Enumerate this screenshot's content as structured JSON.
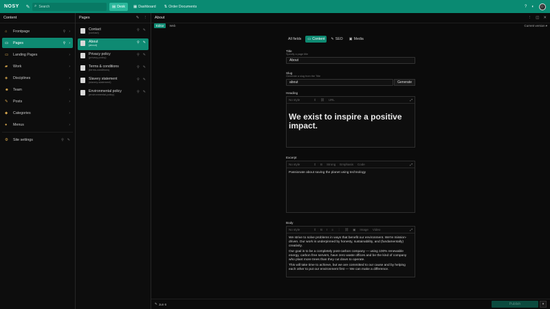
{
  "topbar": {
    "brand": "NOSY",
    "search_placeholder": "Search",
    "tools": [
      {
        "label": "Desk",
        "icon": "desk-icon",
        "active": true
      },
      {
        "label": "Dashboard",
        "icon": "dashboard-icon",
        "active": false
      },
      {
        "label": "Order Documents",
        "icon": "order-documents-icon",
        "active": false
      }
    ]
  },
  "content_pane": {
    "title": "Content",
    "items": [
      {
        "label": "Frontpage",
        "icon": "home-icon"
      },
      {
        "label": "Pages",
        "icon": "pages-icon",
        "active": true
      },
      {
        "label": "Landing Pages",
        "icon": "landing-pages-icon"
      },
      {
        "label": "Work",
        "icon": "work-icon"
      },
      {
        "label": "Disciplines",
        "icon": "disciplines-icon"
      },
      {
        "label": "Team",
        "icon": "team-icon"
      },
      {
        "label": "Posts",
        "icon": "posts-icon"
      },
      {
        "label": "Categories",
        "icon": "categories-icon"
      },
      {
        "label": "Menus",
        "icon": "menus-icon"
      },
      {
        "label": "Site settings",
        "icon": "settings-icon"
      }
    ]
  },
  "pages_pane": {
    "title": "Pages",
    "docs": [
      {
        "title": "Contact",
        "slug": "(contact)"
      },
      {
        "title": "About",
        "slug": "(about)",
        "active": true
      },
      {
        "title": "Privacy policy",
        "slug": "(privacy-policy)"
      },
      {
        "title": "Terms & conditions",
        "slug": "(terms-conditions)"
      },
      {
        "title": "Slavery statement",
        "slug": "(slavery-statement)"
      },
      {
        "title": "Environmental policy",
        "slug": "(environmental-policy)"
      }
    ]
  },
  "doc": {
    "title": "About",
    "view_tabs": [
      "Editor",
      "Web"
    ],
    "version": "Current version",
    "form_tabs": [
      "All fields",
      "Content",
      "SEO",
      "Media"
    ],
    "title_field": {
      "label": "Title",
      "desc": "Specify a page title",
      "value": "About"
    },
    "slug_field": {
      "label": "Slug",
      "desc": "Generate a slug from the Title",
      "value": "about",
      "button": "Generate"
    },
    "heading_field": {
      "label": "Heading",
      "style": "No style",
      "url": "URL",
      "text": "We exist to inspire a positive impact."
    },
    "excerpt_field": {
      "label": "Excerpt",
      "style": "No style",
      "strong": "Strong",
      "emphasis": "Emphasis",
      "code": "Code",
      "text": "Passionate about saving the planet using technology"
    },
    "body_field": {
      "label": "Body",
      "style": "No style",
      "image": "Image",
      "video": "Video",
      "paragraphs": [
        "We strive to solve problems in ways that benefit our environment. We're mission-driven. Our work is underpinned by honesty, sustainability, and (fundamentally) creativity.",
        "Our goal is to be a completely post-carbon company — using 100% renewable energy, carbon free servers, have zero waste offices and be the kind of company who plant more trees than they cut down to operate.",
        "This will take time to achieve, but we are committed to our cause and by helping each other to put our environment first — We can make a difference."
      ]
    },
    "footer": {
      "date": "Jun 6",
      "publish": "Publish"
    }
  }
}
